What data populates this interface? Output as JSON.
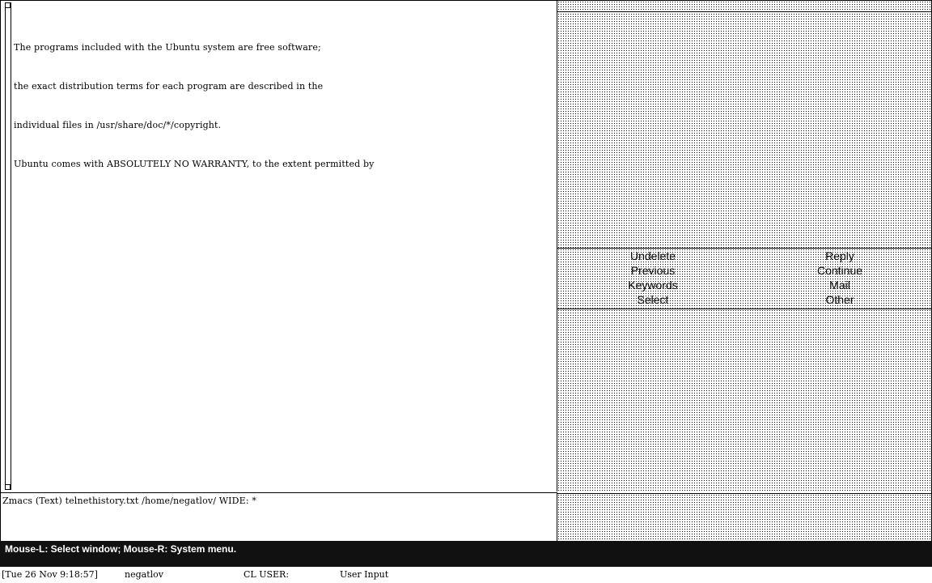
{
  "editor": {
    "lines": [
      "The programs included with the Ubuntu system are free software;",
      "the exact distribution terms for each program are described in the",
      "individual files in /usr/share/doc/*/copyright.",
      "Ubuntu comes with ABSOLUTELY NO WARRANTY, to the extent permitted by"
    ]
  },
  "mode_line": "Zmacs (Text) telnethistory.txt /home/negatlov/ WIDE: *",
  "menu": {
    "left": [
      "Undelete",
      "Previous",
      "Keywords",
      "Select"
    ],
    "right": [
      "Reply",
      "Continue",
      "Mail",
      "Other"
    ]
  },
  "mouse_doc": "Mouse-L: Select window; Mouse-R: System menu.",
  "status": {
    "datetime": "[Tue 26 Nov 9:18:57]",
    "user": "negatlov",
    "package": "CL USER:",
    "state": "User Input"
  }
}
